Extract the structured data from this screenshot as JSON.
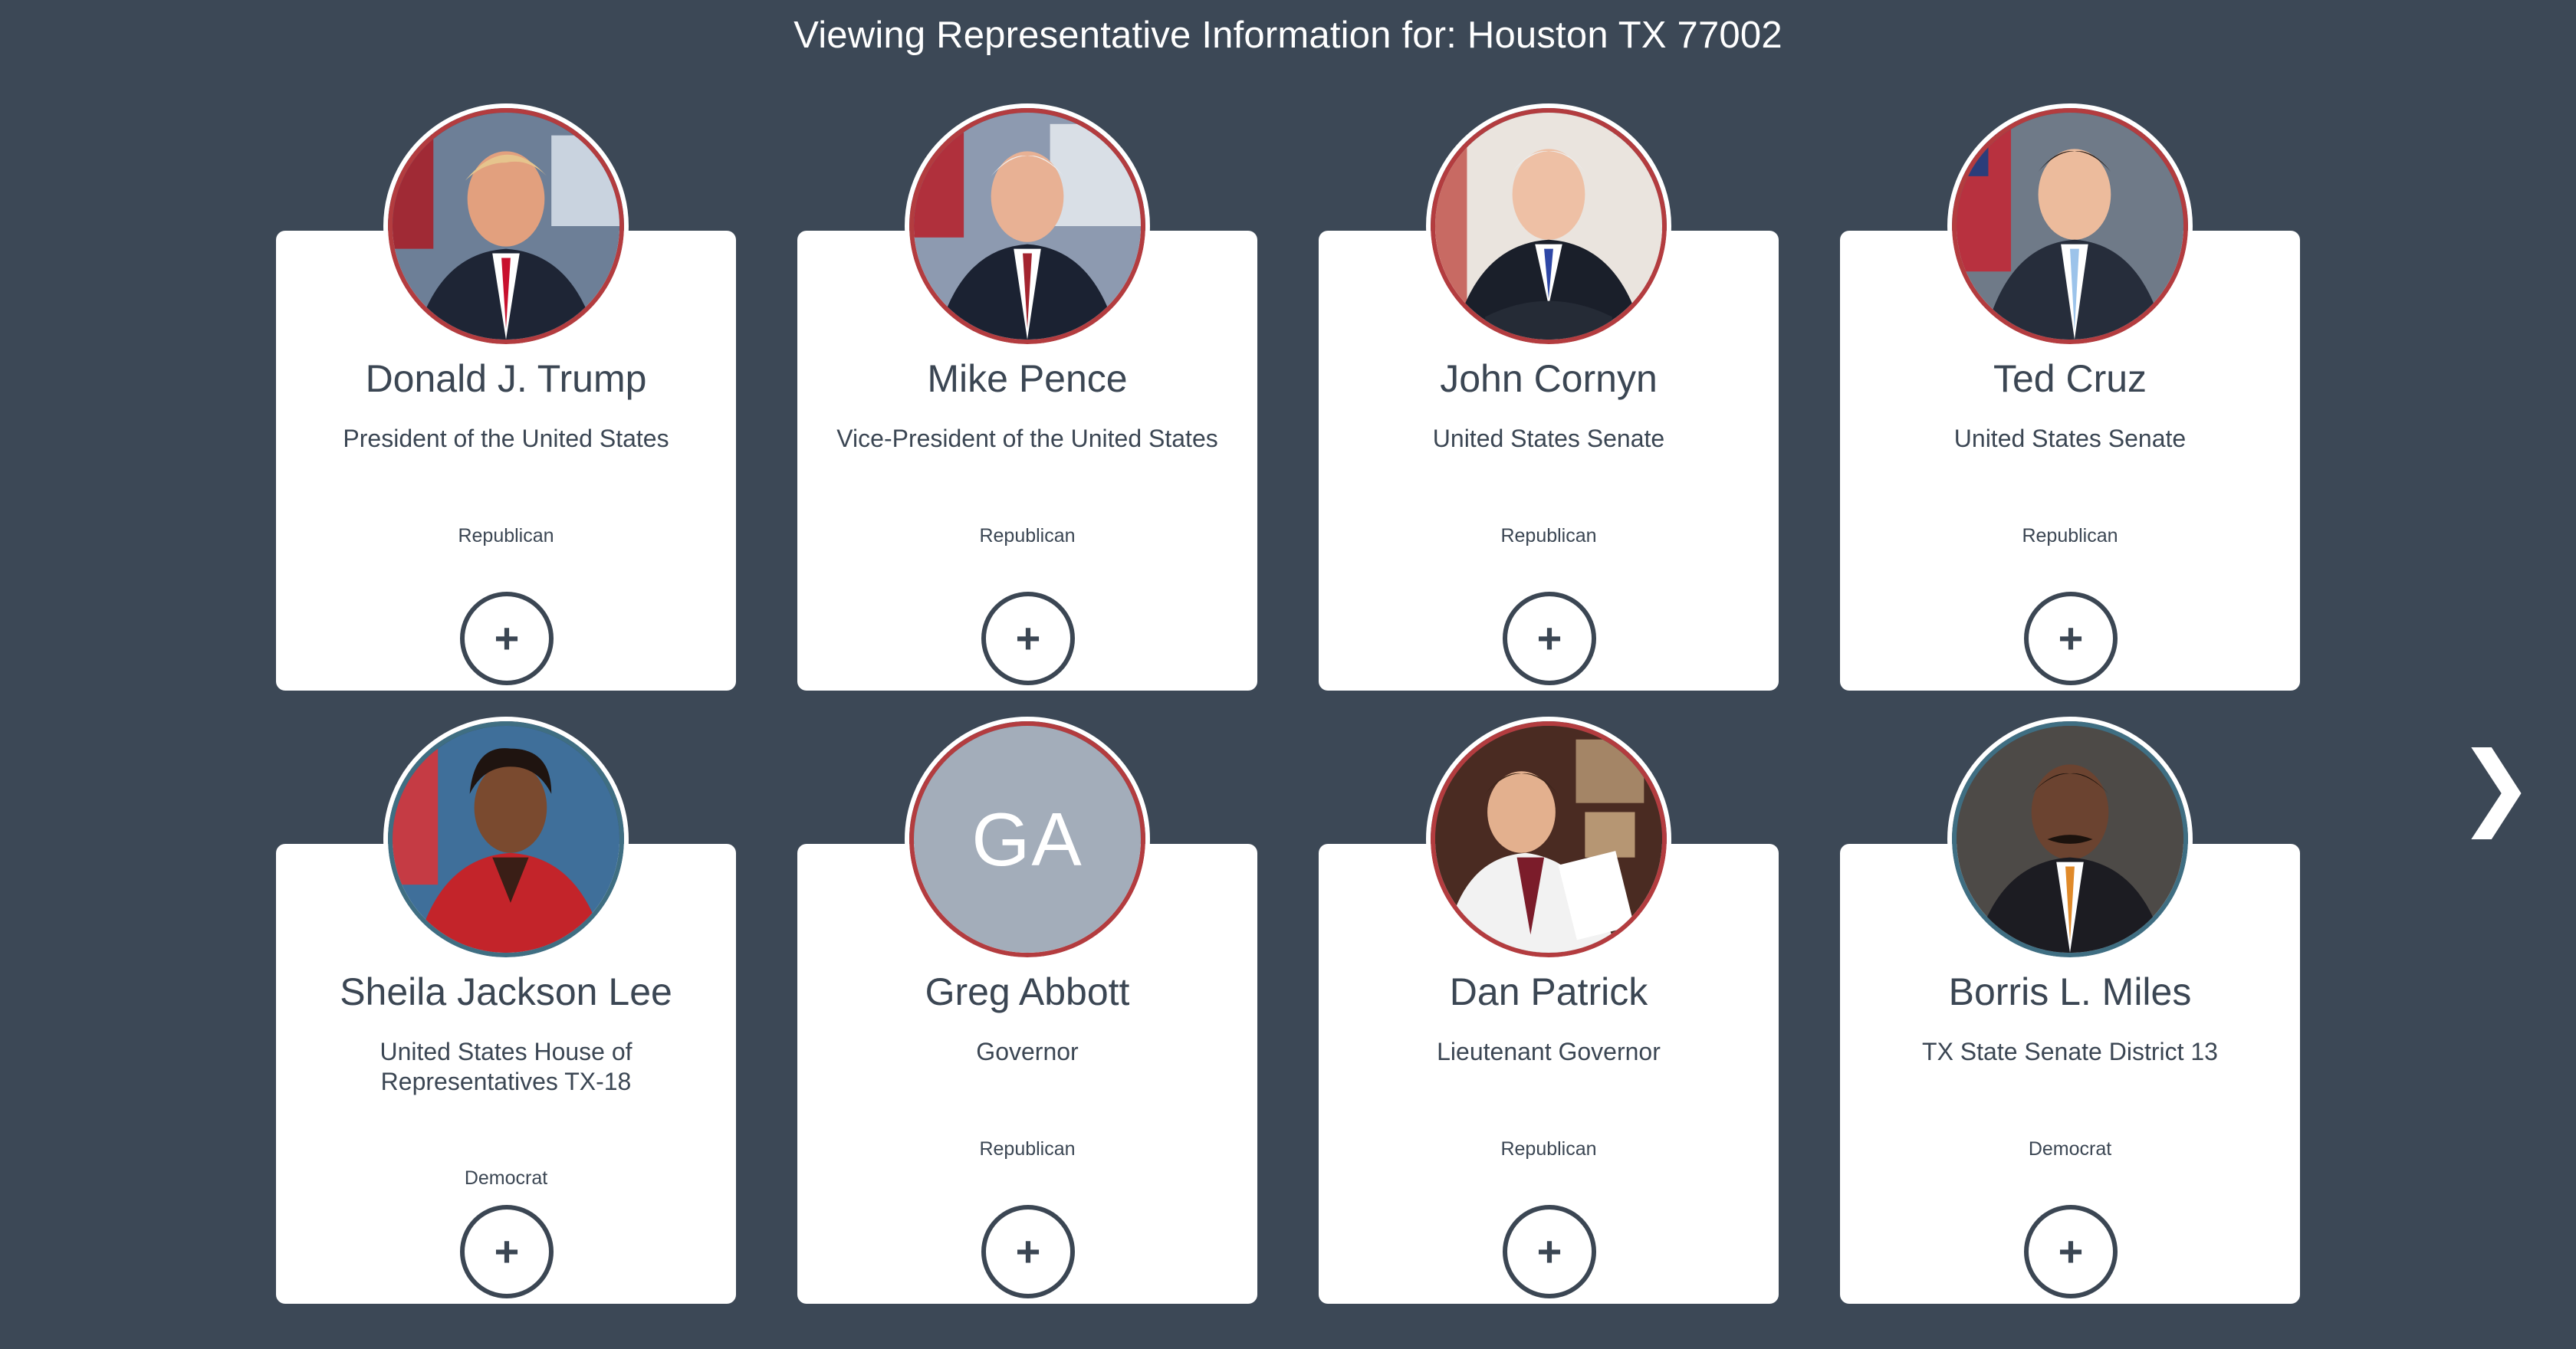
{
  "header": {
    "title": "Viewing Representative Information for: Houston TX 77002"
  },
  "representatives": [
    {
      "name": "Donald J. Trump",
      "office": "President of the United States",
      "party": "Republican",
      "party_color": "#b33c3f",
      "avatar": "photo",
      "add_label": "+"
    },
    {
      "name": "Mike Pence",
      "office": "Vice-President of the United States",
      "party": "Republican",
      "party_color": "#b33c3f",
      "avatar": "photo",
      "add_label": "+"
    },
    {
      "name": "John Cornyn",
      "office": "United States Senate",
      "party": "Republican",
      "party_color": "#b33c3f",
      "avatar": "photo",
      "add_label": "+"
    },
    {
      "name": "Ted Cruz",
      "office": "United States Senate",
      "party": "Republican",
      "party_color": "#b33c3f",
      "avatar": "photo",
      "add_label": "+"
    },
    {
      "name": "Sheila Jackson Lee",
      "office": "United States House of Representatives TX-18",
      "party": "Democrat",
      "party_color": "#3f6e82",
      "avatar": "photo",
      "add_label": "+"
    },
    {
      "name": "Greg Abbott",
      "office": "Governor",
      "party": "Republican",
      "party_color": "#b33c3f",
      "avatar": "initials",
      "initials": "GA",
      "add_label": "+"
    },
    {
      "name": "Dan Patrick",
      "office": "Lieutenant Governor",
      "party": "Republican",
      "party_color": "#b33c3f",
      "avatar": "photo",
      "add_label": "+"
    },
    {
      "name": "Borris L. Miles",
      "office": "TX State Senate District 13",
      "party": "Democrat",
      "party_color": "#3f6e82",
      "avatar": "photo",
      "add_label": "+"
    }
  ],
  "navigation": {
    "next_icon": "chevron-right-icon",
    "next_glyph": "❯"
  },
  "colors": {
    "background": "#3c4856",
    "card": "#ffffff",
    "republican": "#b33c3f",
    "democrat": "#3f6e82",
    "text": "#3b4653"
  }
}
